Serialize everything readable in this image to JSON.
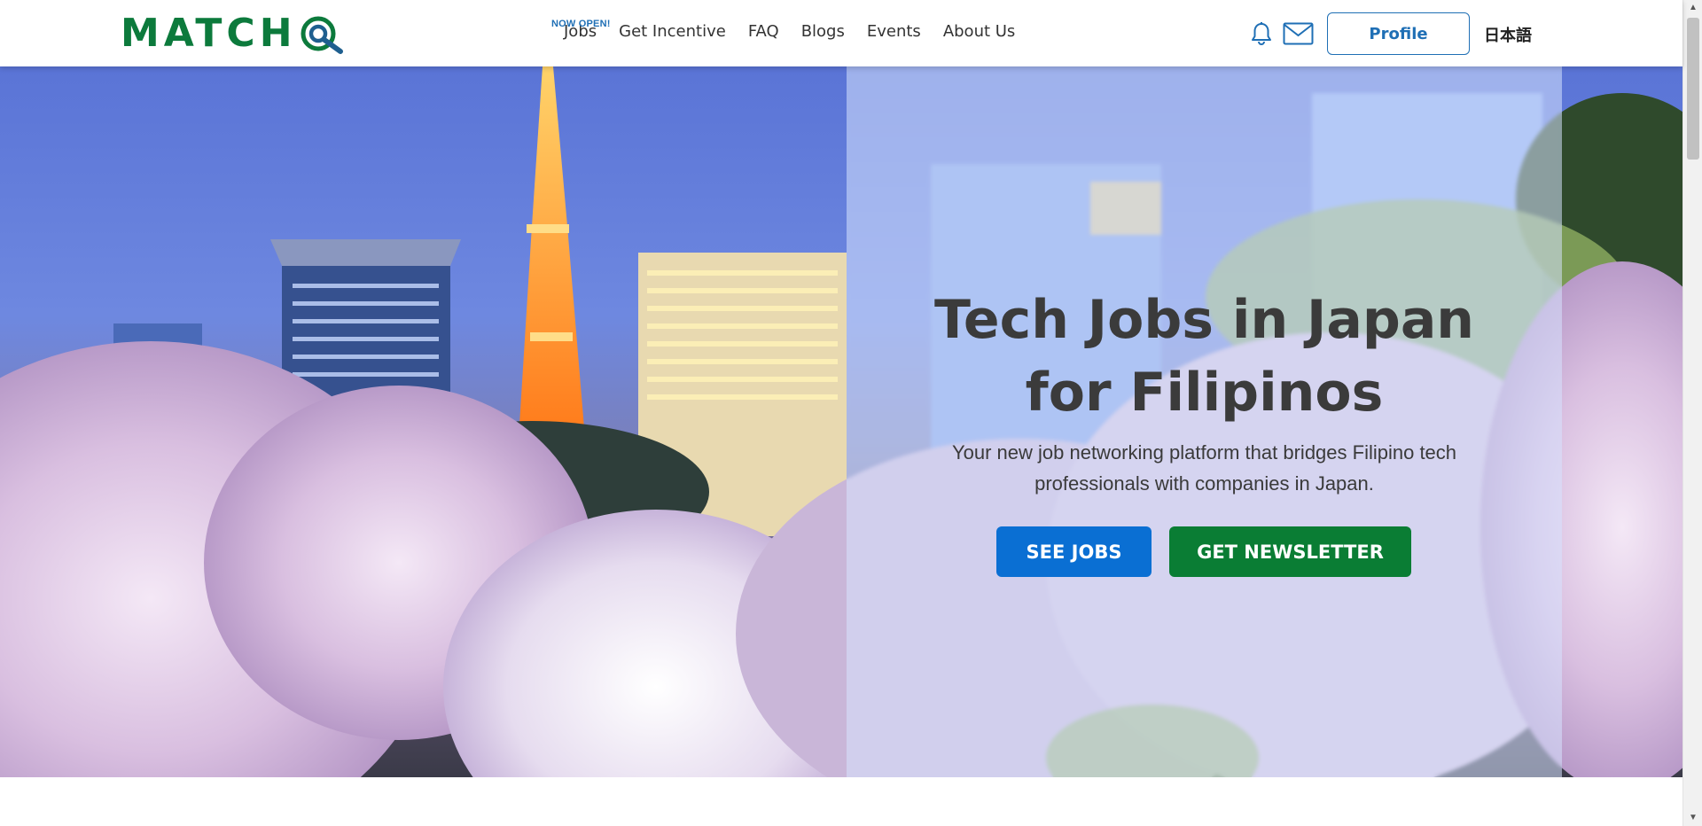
{
  "header": {
    "logo_text": "MATCH",
    "nav": [
      {
        "label": "Jobs",
        "badge": "NOW OPEN!"
      },
      {
        "label": "Get Incentive"
      },
      {
        "label": "FAQ"
      },
      {
        "label": "Blogs"
      },
      {
        "label": "Events"
      },
      {
        "label": "About Us"
      }
    ],
    "notifications_icon": "bell-icon",
    "messages_icon": "mail-icon",
    "profile_label": "Profile",
    "language_label": "日本語"
  },
  "hero": {
    "title_line1": "Tech Jobs in Japan",
    "title_line2": "for Filipinos",
    "subtitle": "Your new job networking platform that bridges Filipino tech professionals with companies in Japan.",
    "see_jobs_label": "SEE JOBS",
    "newsletter_label": "GET NEWSLETTER",
    "background_icon": "tokyo-tower-cherry-blossom-image"
  },
  "colors": {
    "brand_green": "#0c7a3c",
    "brand_blue": "#1f6fb5",
    "see_jobs_bg": "#0a6fd3",
    "newsletter_bg": "#0a7d34"
  }
}
